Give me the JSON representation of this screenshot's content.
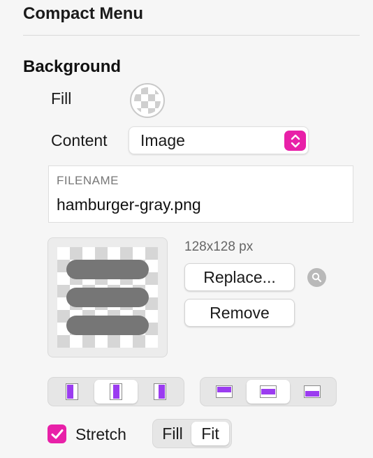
{
  "panel": {
    "section_title": "Compact Menu",
    "background_heading": "Background"
  },
  "fill": {
    "label": "Fill",
    "swatch_icon": "checkerboard-transparent-icon"
  },
  "content": {
    "label": "Content",
    "selected": "Image",
    "accent": "#e820a8"
  },
  "file": {
    "caption": "FILENAME",
    "name": "hamburger-gray.png",
    "preview_icon": "hamburger-menu-icon",
    "dimensions": "128x128 px",
    "replace_label": "Replace...",
    "remove_label": "Remove",
    "zoom_icon": "magnifier-icon"
  },
  "alignment": {
    "horizontal": {
      "options": [
        "align-left-icon",
        "align-center-horizontal-icon",
        "align-right-icon"
      ],
      "selected_index": 1
    },
    "vertical": {
      "options": [
        "align-top-icon",
        "align-middle-vertical-icon",
        "align-bottom-icon"
      ],
      "selected_index": 1
    },
    "accent": "#9b3cf0"
  },
  "stretch": {
    "label": "Stretch",
    "checked": true,
    "modes": [
      "Fill",
      "Fit"
    ],
    "selected_mode": "Fit"
  }
}
